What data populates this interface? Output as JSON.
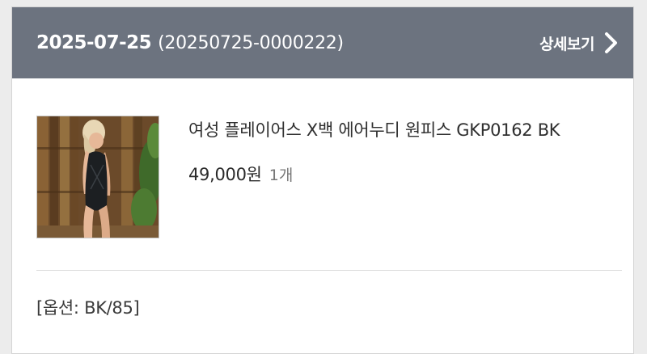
{
  "order": {
    "date": "2025-07-25",
    "number": "(20250725-0000222)",
    "details_label": "상세보기",
    "details_icon": "chevron-right-icon"
  },
  "product": {
    "name": "여성 플레이어스 X백 에어누디 원피스 GKP0162 BK",
    "price": "49,000원",
    "quantity": "1개",
    "image_icon": "product-photo"
  },
  "option": {
    "text": "[옵션: BK/85]"
  },
  "colors": {
    "header_bg": "#6c737f",
    "header_text": "#ffffff",
    "card_bg": "#ffffff",
    "page_bg": "#ececec"
  }
}
